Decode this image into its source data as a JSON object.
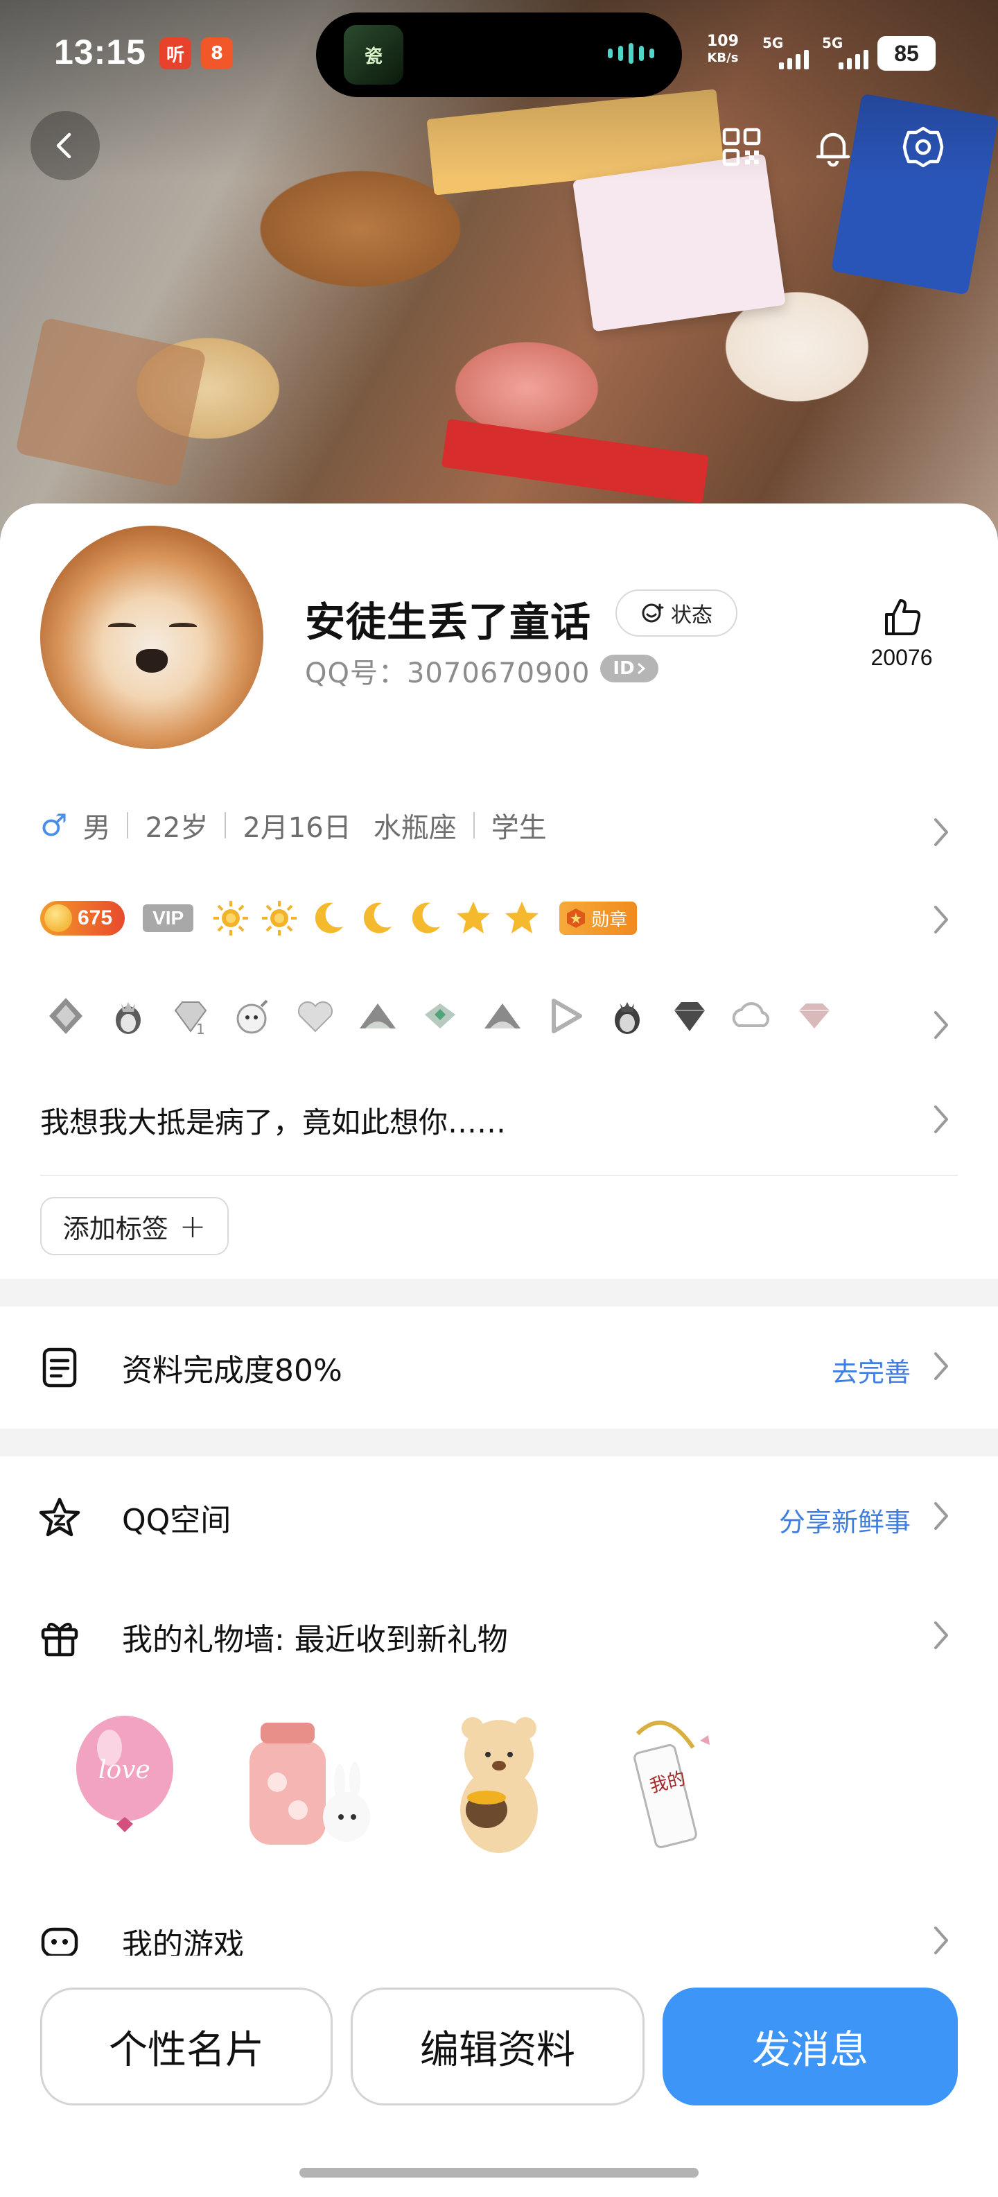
{
  "status_bar": {
    "time": "13:15",
    "app1": "听",
    "app2": "8",
    "net_speed_value": "109",
    "net_speed_unit": "KB/s",
    "signal1": "5G",
    "signal2": "5G",
    "battery": "85",
    "island_thumb_text": "瓷"
  },
  "profile": {
    "nickname": "安徒生丢了童话",
    "status_label": "状态",
    "qq_line": "QQ号：3070670900",
    "id_badge": "ID",
    "likes": "20076"
  },
  "info": {
    "gender_icon": "♂",
    "gender": "男",
    "age": "22岁",
    "birthday": "2月16日",
    "zodiac": "水瓶座",
    "occupation": "学生"
  },
  "badges": {
    "level": "675",
    "vip": "VIP",
    "honor": "勋章",
    "level_icons": [
      "sun-icon",
      "sun-icon",
      "moon-icon",
      "moon-icon",
      "moon-icon",
      "star-icon",
      "star-icon"
    ]
  },
  "signature": "我想我大抵是病了，竟如此想你……",
  "tag_button": {
    "label": "添加标签",
    "plus": "+"
  },
  "completion": {
    "title": "资料完成度80%",
    "action": "去完善"
  },
  "qzone": {
    "title": "QQ空间",
    "action": "分享新鲜事"
  },
  "gift_wall": {
    "title": "我的礼物墙: 最近收到新礼物",
    "balloon_text": "love",
    "charm_text": "我的"
  },
  "games": {
    "title": "我的游戏"
  },
  "bottom_buttons": {
    "card": "个性名片",
    "edit": "编辑资料",
    "message": "发消息"
  },
  "colors": {
    "accent": "#3d95f7",
    "link": "#3f7ee0",
    "level_orange": "#e84a2d"
  }
}
